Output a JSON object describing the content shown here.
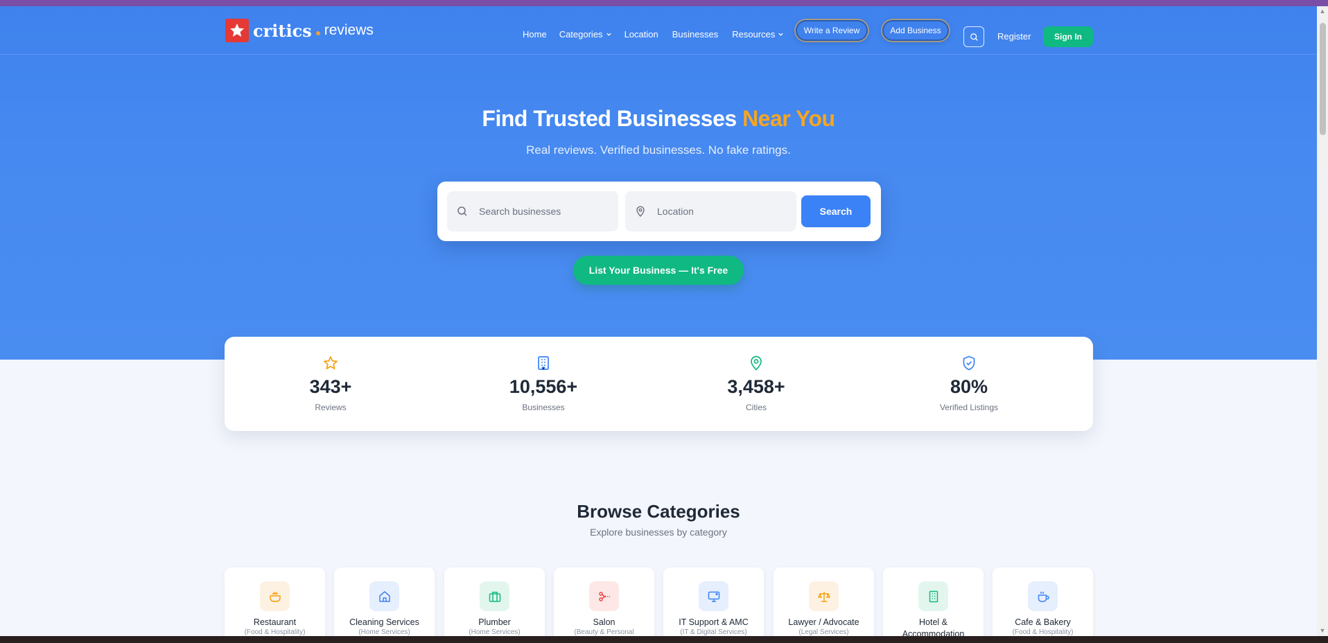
{
  "brand": {
    "name_primary": "critics",
    "name_secondary": "reviews"
  },
  "nav": {
    "links": [
      {
        "label": "Home",
        "dropdown": false
      },
      {
        "label": "Categories",
        "dropdown": true
      },
      {
        "label": "Location",
        "dropdown": false
      },
      {
        "label": "Businesses",
        "dropdown": false
      },
      {
        "label": "Resources",
        "dropdown": true
      }
    ],
    "write_review": "Write a Review",
    "add_business": "Add Business",
    "register": "Register",
    "sign_in": "Sign In"
  },
  "hero": {
    "title_main": "Find Trusted Businesses",
    "title_accent": "Near You",
    "subtitle": "Real reviews. Verified businesses. No fake ratings.",
    "search_placeholder": "Search businesses",
    "location_placeholder": "Location",
    "search_button": "Search",
    "cta": "List Your Business — It's Free"
  },
  "stats": [
    {
      "icon": "star-icon",
      "value": "343+",
      "label": "Reviews",
      "color": "#f59e0b"
    },
    {
      "icon": "building-icon",
      "value": "10,556+",
      "label": "Businesses",
      "color": "#3b82f6"
    },
    {
      "icon": "map-pin-icon",
      "value": "3,458+",
      "label": "Cities",
      "color": "#10b981"
    },
    {
      "icon": "shield-check-icon",
      "value": "80%",
      "label": "Verified Listings",
      "color": "#3b82f6"
    }
  ],
  "categories": {
    "title": "Browse Categories",
    "subtitle": "Explore businesses by category",
    "items": [
      {
        "name": "Restaurant",
        "group": "(Food & Hospitality)",
        "icon": "cooking-pot-icon",
        "color": "#f59e0b",
        "bg": "#fdf1e1"
      },
      {
        "name": "Cleaning Services",
        "group": "(Home Services)",
        "icon": "home-icon",
        "color": "#3b82f6",
        "bg": "#e6effd"
      },
      {
        "name": "Plumber",
        "group": "(Home Services)",
        "icon": "briefcase-icon",
        "color": "#10b981",
        "bg": "#e2f6ee"
      },
      {
        "name": "Salon",
        "group": "(Beauty & Personal",
        "icon": "scissors-icon",
        "color": "#ef4444",
        "bg": "#fde7e7"
      },
      {
        "name": "IT Support & AMC",
        "group": "(IT & Digital Services)",
        "icon": "monitor-icon",
        "color": "#3b82f6",
        "bg": "#e6effd"
      },
      {
        "name": "Lawyer / Advocate",
        "group": "(Legal Services)",
        "icon": "scales-icon",
        "color": "#f59e0b",
        "bg": "#fdf1e1"
      },
      {
        "name": "Hotel &",
        "name2": "Accommodation",
        "group": "",
        "icon": "building-icon",
        "color": "#10b981",
        "bg": "#e2f6ee"
      },
      {
        "name": "Cafe & Bakery",
        "group": "(Food & Hospitality)",
        "icon": "coffee-icon",
        "color": "#3b82f6",
        "bg": "#e6effd"
      }
    ]
  }
}
